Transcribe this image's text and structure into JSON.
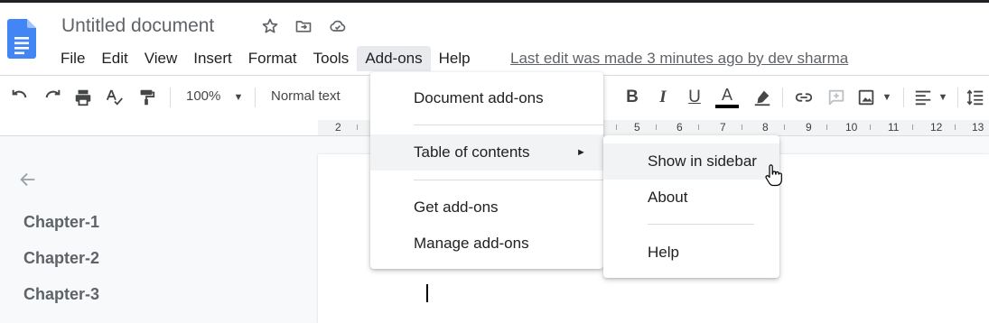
{
  "doc": {
    "title": "Untitled document"
  },
  "menubar": {
    "items": [
      "File",
      "Edit",
      "View",
      "Insert",
      "Format",
      "Tools",
      "Add-ons",
      "Help"
    ]
  },
  "last_edit": "Last edit was made 3 minutes ago by dev sharma",
  "toolbar": {
    "zoom": "100%",
    "style": "Normal text"
  },
  "ruler": {
    "labels": [
      "2",
      "5",
      "6",
      "7",
      "8",
      "9",
      "10",
      "11",
      "12",
      "13"
    ]
  },
  "outline": {
    "items": [
      "Chapter-1",
      "Chapter-2",
      "Chapter-3"
    ]
  },
  "addons_menu": {
    "items": [
      "Document add-ons",
      "Table of contents",
      "Get add-ons",
      "Manage add-ons"
    ],
    "submenu_arrow": "►"
  },
  "toc_submenu": {
    "items": [
      "Show in sidebar",
      "About",
      "Help"
    ]
  },
  "colors": {
    "accent": "#4285f4",
    "text_color_bar": "#000000"
  }
}
